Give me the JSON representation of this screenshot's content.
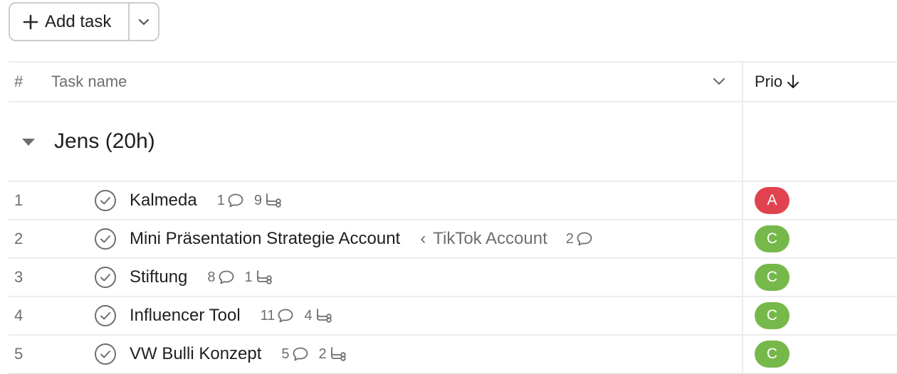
{
  "toolbar": {
    "add_task_label": "Add task"
  },
  "header": {
    "hash": "#",
    "task_name": "Task name",
    "prio": "Prio"
  },
  "section": {
    "title": "Jens (20h)"
  },
  "colors": {
    "prio_A": "#e0434f",
    "prio_C": "#77b84a",
    "border": "#ececec"
  },
  "tasks": [
    {
      "num": "1",
      "name": "Kalmeda",
      "parent": "",
      "comments": "1",
      "subtasks": "9",
      "prio": "A"
    },
    {
      "num": "2",
      "name": "Mini Präsentation Strategie Account",
      "parent": "TikTok Account",
      "comments": "2",
      "subtasks": "",
      "prio": "C"
    },
    {
      "num": "3",
      "name": "Stiftung",
      "parent": "",
      "comments": "8",
      "subtasks": "1",
      "prio": "C"
    },
    {
      "num": "4",
      "name": "Influencer Tool",
      "parent": "",
      "comments": "11",
      "subtasks": "4",
      "prio": "C"
    },
    {
      "num": "5",
      "name": "VW Bulli Konzept",
      "parent": "",
      "comments": "5",
      "subtasks": "2",
      "prio": "C"
    }
  ]
}
